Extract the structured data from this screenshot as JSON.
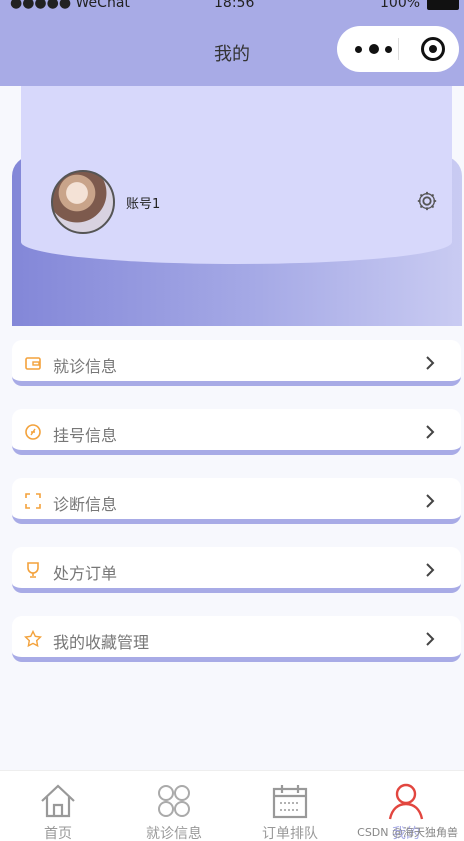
{
  "status_bar": {
    "carrier": "●●●●● WeChat",
    "time": "18:56",
    "battery": "100%"
  },
  "nav": {
    "title": "我的"
  },
  "profile": {
    "username": "账号1"
  },
  "menu": [
    {
      "label": "就诊信息",
      "icon": "wallet-icon"
    },
    {
      "label": "挂号信息",
      "icon": "coin-icon"
    },
    {
      "label": "诊断信息",
      "icon": "scan-icon"
    },
    {
      "label": "处方订单",
      "icon": "trophy-icon"
    },
    {
      "label": "我的收藏管理",
      "icon": "star-icon"
    }
  ],
  "tabs": [
    {
      "label": "首页",
      "icon": "home-icon"
    },
    {
      "label": "就诊信息",
      "icon": "grid-icon"
    },
    {
      "label": "订单排队",
      "icon": "calendar-icon"
    },
    {
      "label": "我的",
      "icon": "user-icon"
    }
  ],
  "colors": {
    "accent": "#a8abe6",
    "card": "#d7d8fb",
    "icon_orange": "#f3a23c",
    "tab_active": "#e2463f"
  },
  "watermark": "CSDN @海天独角兽"
}
